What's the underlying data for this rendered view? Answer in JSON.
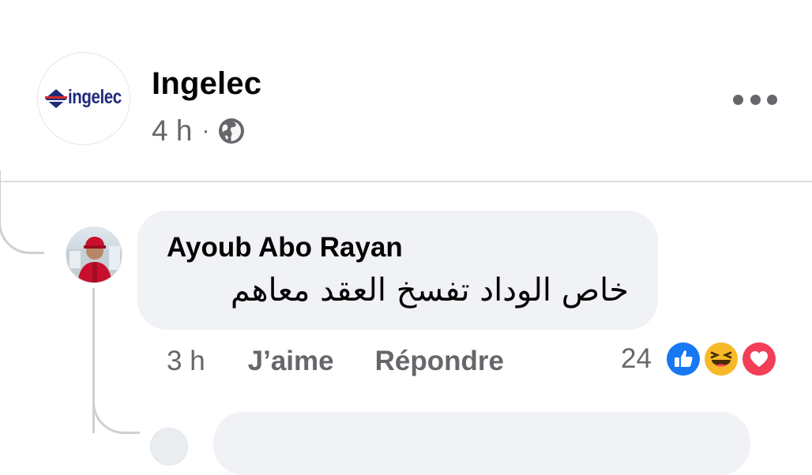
{
  "post": {
    "page_name": "Ingelec",
    "logo_text": "ingelec",
    "time": "4 h",
    "separator": "·",
    "audience_icon": "globe-icon",
    "more_icon": "more-options-icon"
  },
  "comment": {
    "author": "Ayoub Abo Rayan",
    "text": "خاص الوداد تفسخ العقد معاهم",
    "time": "3 h",
    "like_label": "J’aime",
    "reply_label": "Répondre",
    "reaction_count": "24",
    "reactions": [
      "like-reaction-icon",
      "haha-reaction-icon",
      "love-reaction-icon"
    ]
  },
  "colors": {
    "secondary_text": "#65676b",
    "bubble": "#f0f2f5",
    "like_blue": "#1877f2",
    "love_red": "#f33e58",
    "haha_yellow": "#f7b928",
    "logo_blue": "#1f2a7a",
    "logo_red": "#d62b2b"
  }
}
